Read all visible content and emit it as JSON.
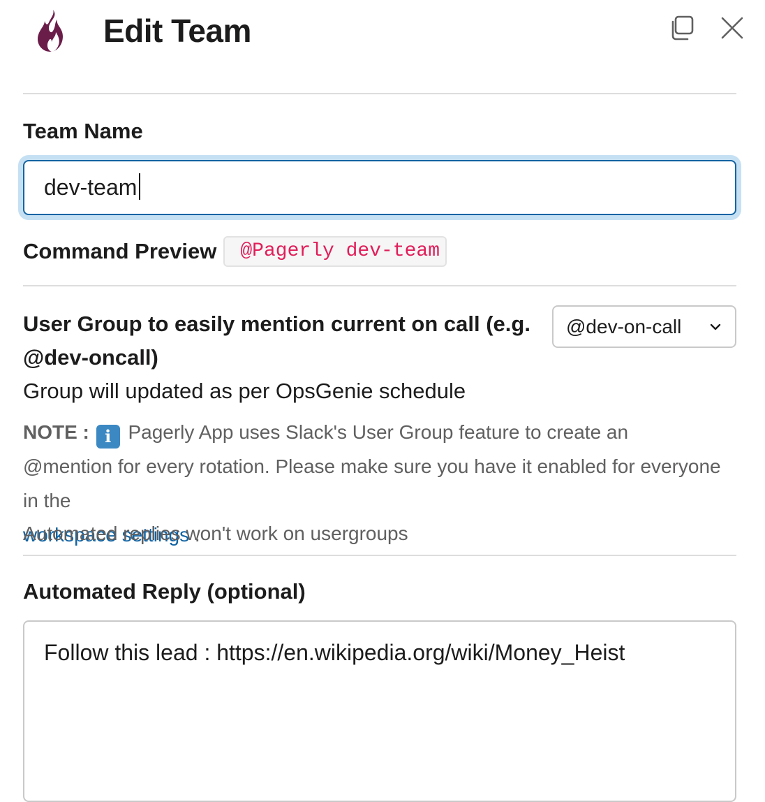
{
  "header": {
    "title": "Edit Team",
    "logo_icon": "flame-icon",
    "logo_color": "#6b1d4a",
    "popout_icon": "popout-icon",
    "close_icon": "close-icon"
  },
  "team_name": {
    "label": "Team Name",
    "value": "dev-team"
  },
  "command_preview": {
    "label": "Command Preview",
    "code": "@Pagerly dev-team"
  },
  "user_group": {
    "label": "User Group to easily mention current on call (e.g. @dev-oncall)",
    "hint": "Group will updated as per OpsGenie schedule",
    "selected": "@dev-on-call",
    "note_prefix": "NOTE :",
    "note_text": "Pagerly App uses Slack's User Group feature to create an @mention for every rotation. Please make sure you have it enabled for everyone in the",
    "link_text": "workspace settings",
    "note_suffix": ".",
    "footnote": "Automated replies won't work on usergroups"
  },
  "automated_reply": {
    "label": "Automated Reply (optional)",
    "value": "Follow this lead : https://en.wikipedia.org/wiki/Money_Heist"
  },
  "colors": {
    "accent": "#1264a3",
    "code": "#e01e5a",
    "muted": "#616061"
  }
}
